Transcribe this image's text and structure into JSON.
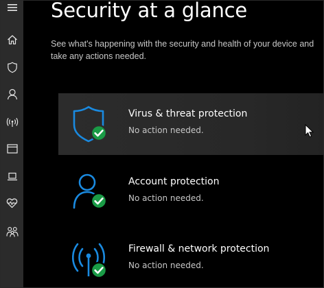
{
  "page": {
    "title": "Security at a glance",
    "subtitle": "See what's happening with the security and health of your device and take any actions needed."
  },
  "sidebar": {
    "items": [
      {
        "name": "menu",
        "icon": "hamburger-menu-icon"
      },
      {
        "name": "home",
        "icon": "home-icon"
      },
      {
        "name": "virus-protection",
        "icon": "shield-icon"
      },
      {
        "name": "account",
        "icon": "person-icon"
      },
      {
        "name": "firewall",
        "icon": "wireless-signal-icon"
      },
      {
        "name": "app-browser",
        "icon": "browser-window-icon"
      },
      {
        "name": "device-security",
        "icon": "laptop-icon"
      },
      {
        "name": "device-health",
        "icon": "heart-pulse-icon"
      },
      {
        "name": "family",
        "icon": "family-icon"
      }
    ]
  },
  "cards": [
    {
      "title": "Virus & threat protection",
      "status": "No action needed.",
      "icon": "shield-icon"
    },
    {
      "title": "Account protection",
      "status": "No action needed.",
      "icon": "person-icon"
    },
    {
      "title": "Firewall & network protection",
      "status": "No action needed.",
      "icon": "wireless-signal-icon"
    }
  ],
  "status_badge": {
    "icon": "checkmark-icon",
    "color": "#1a9b46"
  },
  "colors": {
    "accent": "#1a8ae0",
    "background": "#000000",
    "sidebar": "#2b2b2b",
    "card_hover": "#2a2a2a",
    "ok_green": "#1a9b46"
  }
}
